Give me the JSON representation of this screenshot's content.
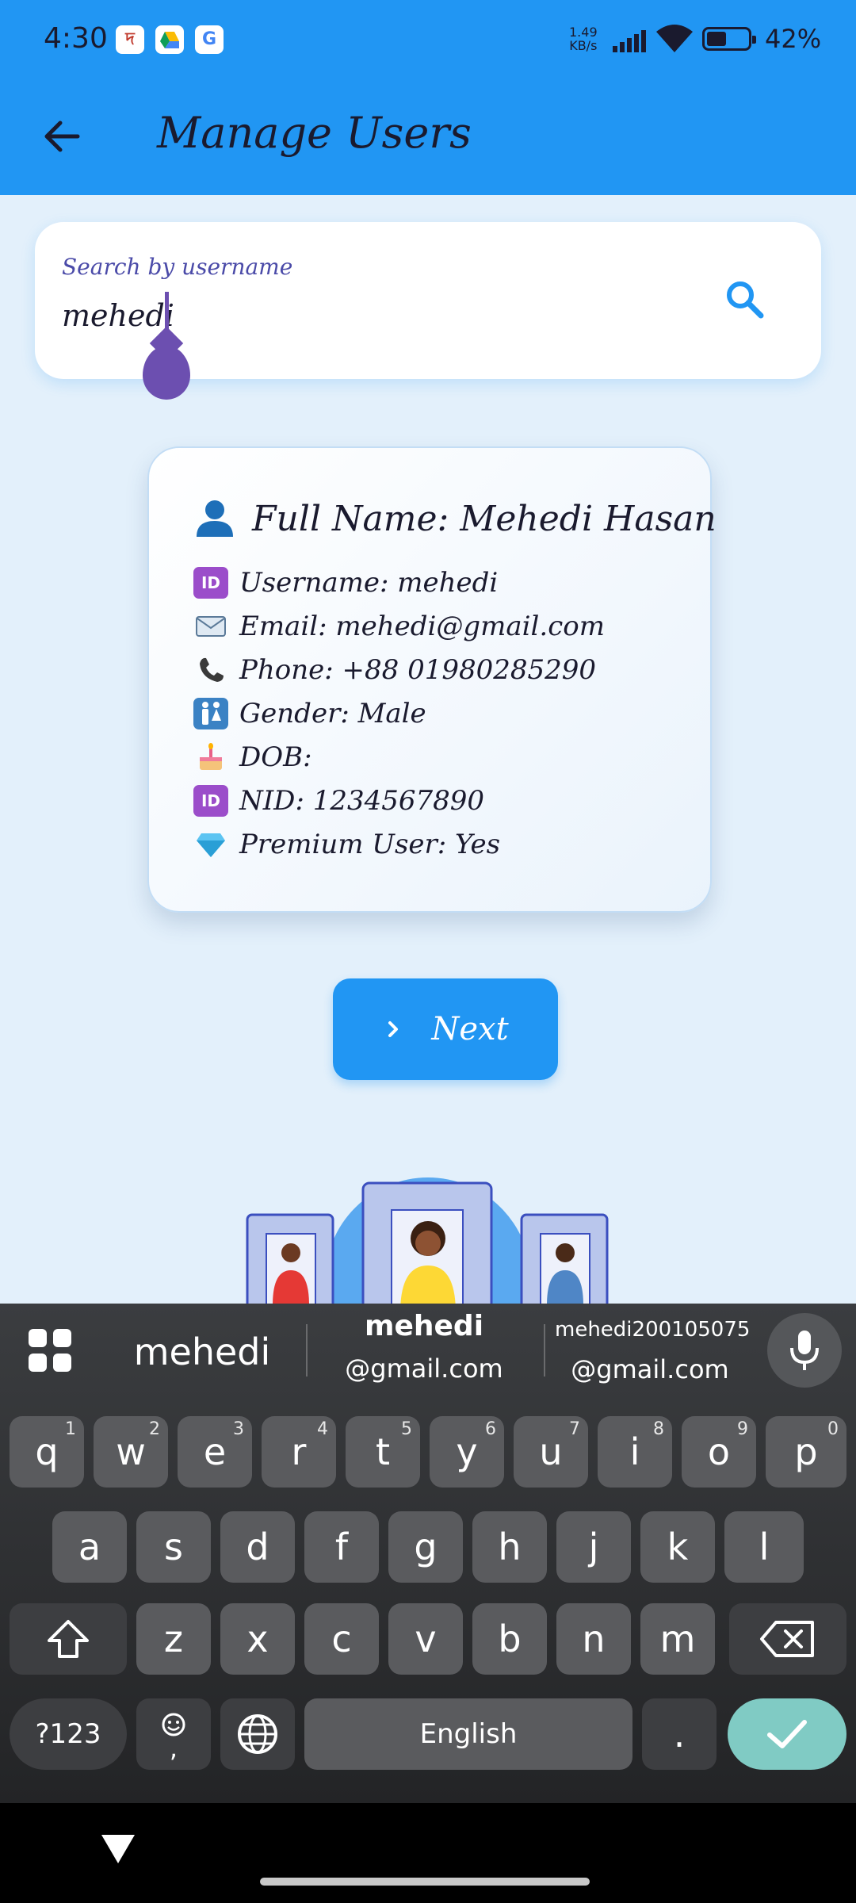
{
  "status_bar": {
    "time": "4:30",
    "notification_icons": [
      "app-icon",
      "drive-icon",
      "google-icon"
    ],
    "net_speed_value": "1.49",
    "net_speed_unit": "KB/s",
    "battery_percent": "42%"
  },
  "app_bar": {
    "title": "Manage Users",
    "background_color": "#2196f3"
  },
  "search": {
    "label": "Search by username",
    "value": "mehedi"
  },
  "user_card": {
    "full_name": "Full Name: Mehedi Hasan",
    "details": [
      {
        "icon": "id-icon",
        "text": "Username: mehedi"
      },
      {
        "icon": "email-icon",
        "text": "Email: mehedi@gmail.com"
      },
      {
        "icon": "phone-icon",
        "text": "Phone: +88 01980285290"
      },
      {
        "icon": "gender-icon",
        "text": "Gender: Male"
      },
      {
        "icon": "cake-icon",
        "text": "DOB:"
      },
      {
        "icon": "id-icon",
        "text": "NID: 1234567890"
      },
      {
        "icon": "gem-icon",
        "text": "Premium User: Yes"
      }
    ]
  },
  "next_button": {
    "label": "Next"
  },
  "keyboard": {
    "suggestions": {
      "first": "mehedi",
      "second_line1": "mehedi",
      "second_line2": "@gmail.com",
      "third_line1": "mehedi200105075",
      "third_line2": "@gmail.com"
    },
    "row1": [
      {
        "k": "q",
        "s": "1"
      },
      {
        "k": "w",
        "s": "2"
      },
      {
        "k": "e",
        "s": "3"
      },
      {
        "k": "r",
        "s": "4"
      },
      {
        "k": "t",
        "s": "5"
      },
      {
        "k": "y",
        "s": "6"
      },
      {
        "k": "u",
        "s": "7"
      },
      {
        "k": "i",
        "s": "8"
      },
      {
        "k": "o",
        "s": "9"
      },
      {
        "k": "p",
        "s": "0"
      }
    ],
    "row2": [
      "a",
      "s",
      "d",
      "f",
      "g",
      "h",
      "j",
      "k",
      "l"
    ],
    "row3": [
      "z",
      "x",
      "c",
      "v",
      "b",
      "n",
      "m"
    ],
    "symbols_label": "?123",
    "emoji_comma_label": ",",
    "space_label": "English",
    "period_label": ".",
    "accent_color": "#80cbc4"
  }
}
